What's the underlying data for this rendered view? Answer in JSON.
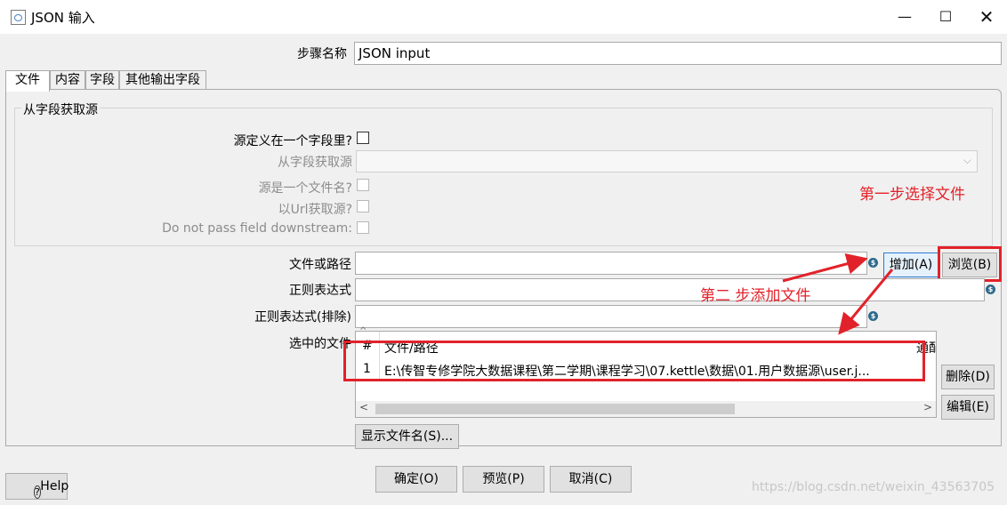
{
  "window": {
    "title": "JSON 输入",
    "minimize": "—",
    "maximize": "☐",
    "close": "✕"
  },
  "step_name": {
    "label": "步骤名称",
    "value": "JSON input"
  },
  "tabs": [
    {
      "label": "文件"
    },
    {
      "label": "内容"
    },
    {
      "label": "字段"
    },
    {
      "label": "其他输出字段"
    }
  ],
  "source_group": {
    "title": "从字段获取源",
    "source_in_field": "源定义在一个字段里?",
    "get_source_from_field": "从字段获取源",
    "source_is_filename": "源是一个文件名?",
    "read_source_as_url": "以Url获取源?",
    "do_not_pass_field": "Do not pass field downstream:"
  },
  "file": {
    "file_or_dir_label": "文件或路径",
    "regex_label": "正则表达式",
    "regex_exclude_label": "正则表达式(排除)",
    "selected_files_label": "选中的文件",
    "add_button": "增加(A)",
    "browse_button": "浏览(B)",
    "delete_button": "删除(D)",
    "edit_button": "编辑(E)",
    "show_filenames_button": "显示文件名(S)..."
  },
  "file_table": {
    "columns": [
      "#",
      "文件/路径",
      "通配"
    ],
    "rows": [
      {
        "num": "1",
        "path": "E:\\传智专修学院大数据课程\\第二学期\\课程学习\\07.kettle\\数据\\01.用户数据源\\user.j..."
      }
    ]
  },
  "annotations": {
    "step1": "第一步选择文件",
    "step2": "第二 步添加文件",
    "accent_color": "#e2222a"
  },
  "footer": {
    "help": "Help",
    "ok": "确定(O)",
    "preview": "预览(P)",
    "cancel": "取消(C)"
  },
  "watermark": "https://blog.csdn.net/weixin_43563705",
  "icons": {
    "variable": "dollar-variable-icon",
    "help": "question-icon",
    "app": "kettle-step-icon"
  }
}
